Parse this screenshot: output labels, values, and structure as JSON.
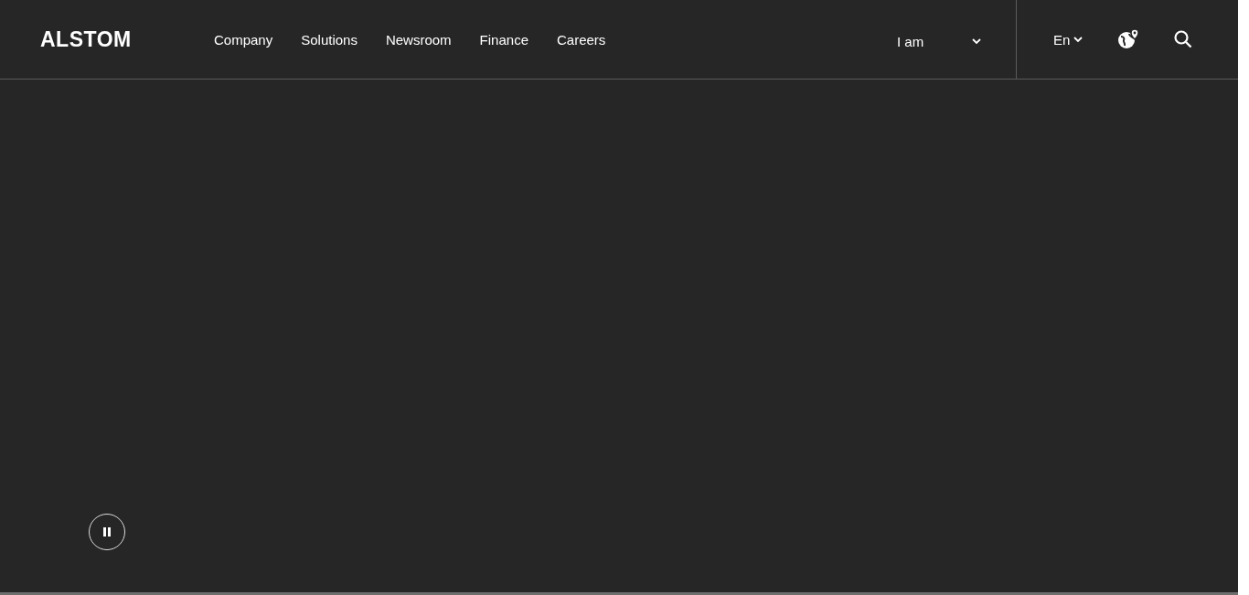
{
  "header": {
    "logo": "ALSTOM",
    "nav": [
      {
        "label": "Company"
      },
      {
        "label": "Solutions"
      },
      {
        "label": "Newsroom"
      },
      {
        "label": "Finance"
      },
      {
        "label": "Careers"
      }
    ],
    "audience_select": {
      "label": "I am"
    },
    "language": {
      "label": "En"
    }
  },
  "hero": {
    "kind": "video",
    "playing": true
  }
}
